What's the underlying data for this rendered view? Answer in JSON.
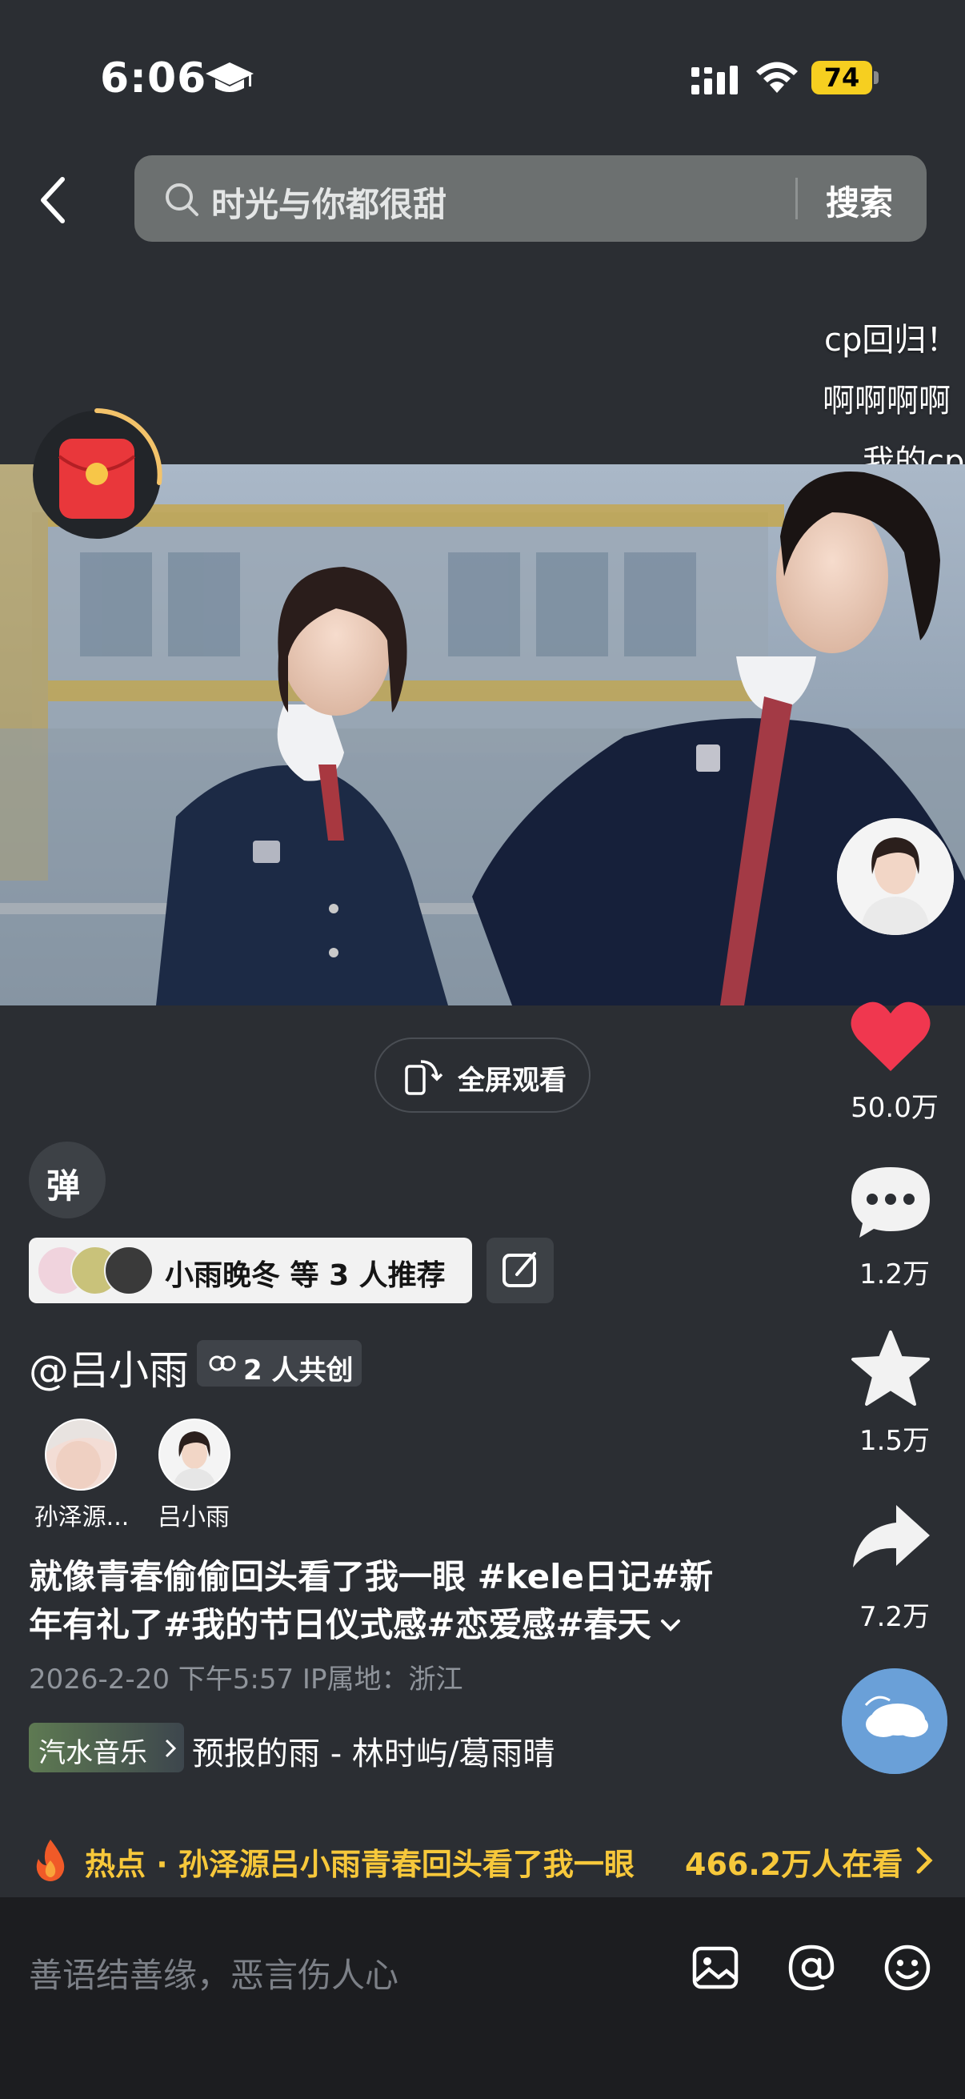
{
  "status": {
    "time": "6:06",
    "battery": "74"
  },
  "search": {
    "placeholder": "时光与你都很甜",
    "button": "搜索"
  },
  "danmaku": [
    "cp回归！",
    "啊啊啊啊",
    "我的cp"
  ],
  "video": {
    "fullscreen_label": "全屏观看"
  },
  "rail": {
    "likes": "50.0万",
    "comments": "1.2万",
    "favorites": "1.5万",
    "shares": "7.2万"
  },
  "danmaku_toggle": "弹",
  "recommend": {
    "text": "小雨晚冬 等 3 人推荐"
  },
  "author": {
    "handle": "@吕小雨",
    "cocreate": "2 人共创"
  },
  "creators": [
    {
      "name": "孙泽源..."
    },
    {
      "name": "吕小雨"
    }
  ],
  "caption": {
    "line1": "就像青春偷偷回头看了我一眼 #kele日记#新",
    "line2": "年有礼了#我的节日仪式感#恋爱感#春天"
  },
  "meta": "2026-2-20 下午5:57  IP属地：浙江",
  "music": {
    "tag": "汽水音乐",
    "title": "预报的雨 - 林时屿/葛雨晴"
  },
  "hot": {
    "text": "热点 · 孙泽源吕小雨青春回头看了我一眼",
    "watching": "466.2万人在看"
  },
  "comment_input": {
    "placeholder": "善语结善缘，恶言伤人心"
  },
  "colors": {
    "like": "#f0374f",
    "hot": "#f7c83b",
    "background": "#2b2e33"
  }
}
